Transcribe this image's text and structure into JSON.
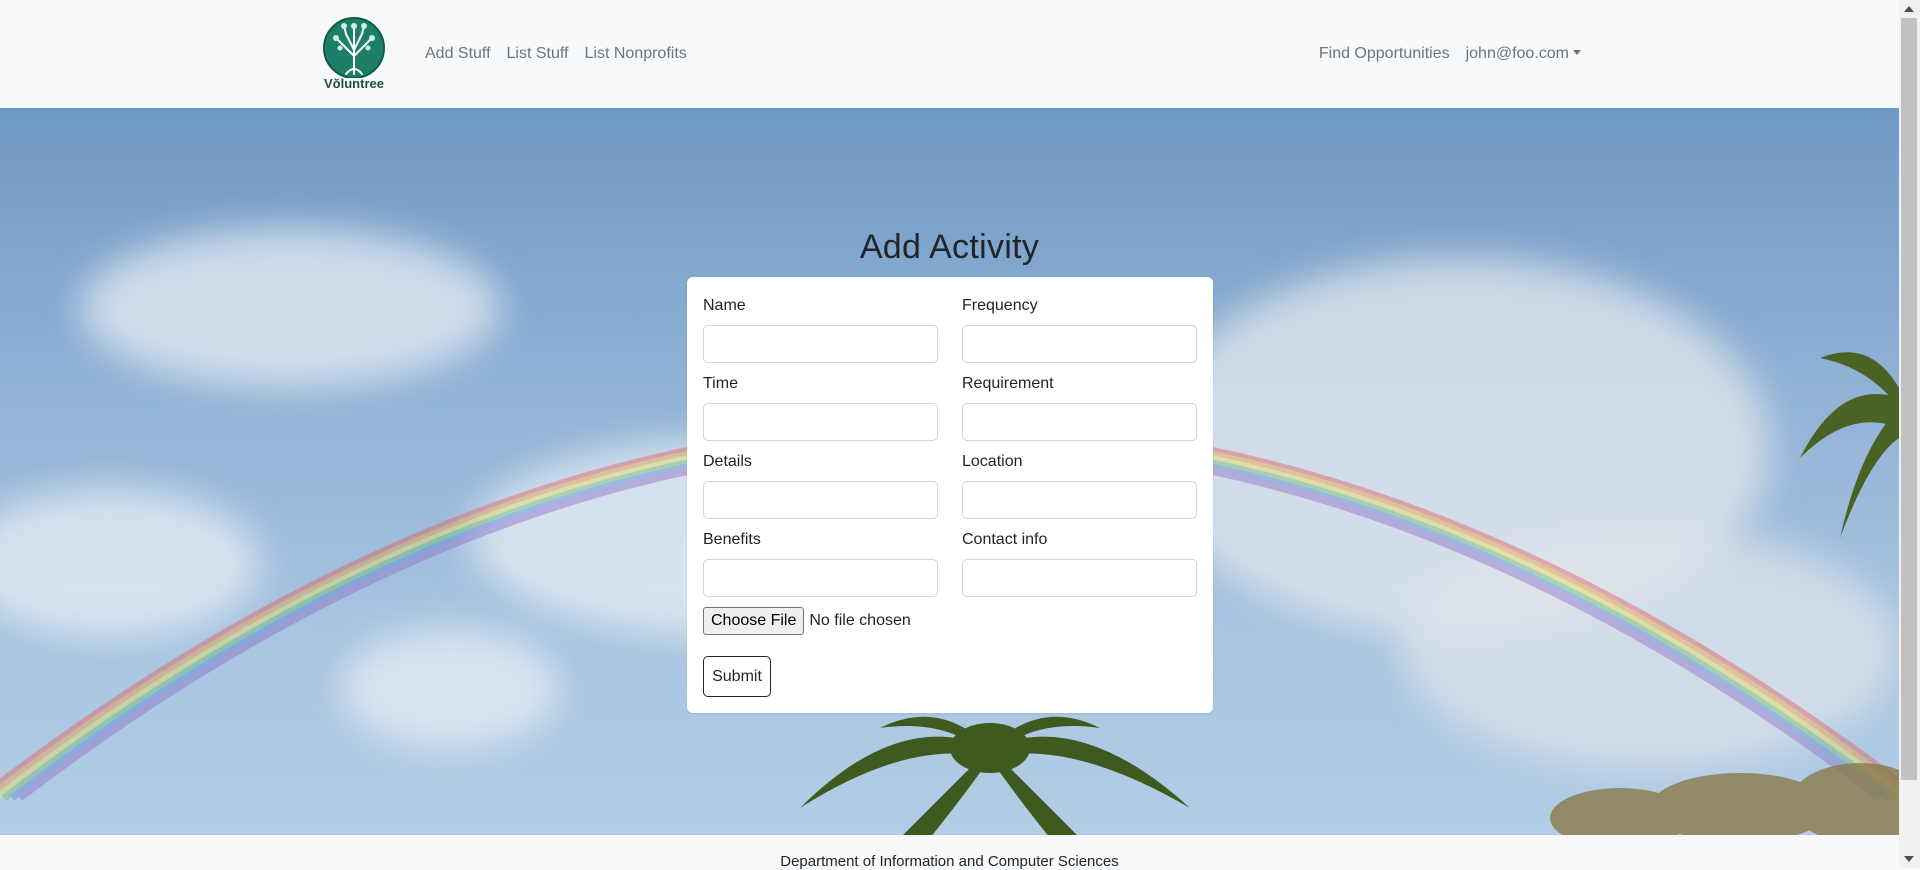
{
  "navbar": {
    "logo_text": "Vŏluntree",
    "links_left": [
      "Add Stuff",
      "List Stuff",
      "List Nonprofits"
    ],
    "find_link": "Find Opportunities",
    "user_menu": "john@foo.com"
  },
  "main": {
    "title": "Add Activity",
    "fields_left": [
      "Name",
      "Time",
      "Details",
      "Benefits"
    ],
    "fields_right": [
      "Frequency",
      "Requirement",
      "Location",
      "Contact info"
    ],
    "file_button": "Choose File",
    "file_status": "No file chosen",
    "submit": "Submit"
  },
  "footer": {
    "text": "Department of Information and Computer Sciences"
  },
  "colors": {
    "logo_green": "#1a8a6b",
    "card_bg": "#ffffff",
    "navbar_bg": "#f8f9fa"
  }
}
